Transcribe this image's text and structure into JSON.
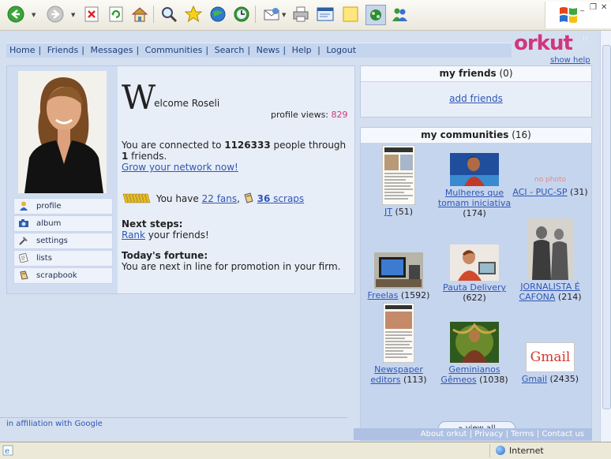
{
  "nav": {
    "items": [
      "Home",
      "Friends",
      "Messages",
      "Communities",
      "Search",
      "News",
      "Help"
    ],
    "logout": "Logout",
    "logo": "orkut",
    "show_help": "show help"
  },
  "profile": {
    "menu": [
      {
        "label": "profile",
        "icon": "person-icon"
      },
      {
        "label": "album",
        "icon": "camera-icon"
      },
      {
        "label": "settings",
        "icon": "tools-icon"
      },
      {
        "label": "lists",
        "icon": "list-icon"
      },
      {
        "label": "scrapbook",
        "icon": "scrapbook-icon"
      }
    ],
    "welcome_initial": "W",
    "welcome_rest": "elcome Roseli",
    "views_label": "profile views:",
    "views_count": "829",
    "connected_pre": "You are connected to ",
    "connected_count": "1126333",
    "connected_mid": " people through ",
    "friends_count": "1",
    "connected_post": " friends.",
    "grow_link": "Grow your network now!",
    "you_have": "You have",
    "fans_link": "22 fans",
    "fans_sep": ",",
    "scraps_count": "36",
    "scraps_word": "scraps",
    "next_steps_title": "Next steps:",
    "rank_link": "Rank",
    "rank_rest": " your friends!",
    "fortune_title": "Today's fortune:",
    "fortune_text": "You are next in line for promotion in your firm."
  },
  "friends_box": {
    "title": "my friends",
    "count": "(0)",
    "add_link": "add friends"
  },
  "communities_box": {
    "title": "my communities",
    "count": "(16)",
    "items": [
      {
        "name": "JT",
        "count": "(51)"
      },
      {
        "name": "Mulheres que tomam iniciativa",
        "count": "(174)"
      },
      {
        "name": "ACI - PUC-SP",
        "count": "(31)",
        "placeholder": "no photo"
      },
      {
        "name": "Freelas",
        "count": "(1592)"
      },
      {
        "name": "Pauta Delivery",
        "count": "(622)"
      },
      {
        "name": "JORNALISTA É CAFONA",
        "count": "(214)"
      },
      {
        "name": "Newspaper editors",
        "count": "(113)"
      },
      {
        "name": "Geminianos Gêmeos",
        "count": "(1038)"
      },
      {
        "name": "Gmail",
        "count": "(2435)",
        "logo": "Gmail"
      }
    ],
    "view_all": "view all"
  },
  "footer": {
    "affiliation": "in affiliation with Google",
    "links": [
      "About orkut",
      "Privacy",
      "Terms",
      "Contact us"
    ]
  },
  "statusbar": {
    "zone": "Internet"
  },
  "colors": {
    "accent_pink": "#d2367a",
    "link_blue": "#2e57b4",
    "panel_blue": "#c6d5ee"
  }
}
